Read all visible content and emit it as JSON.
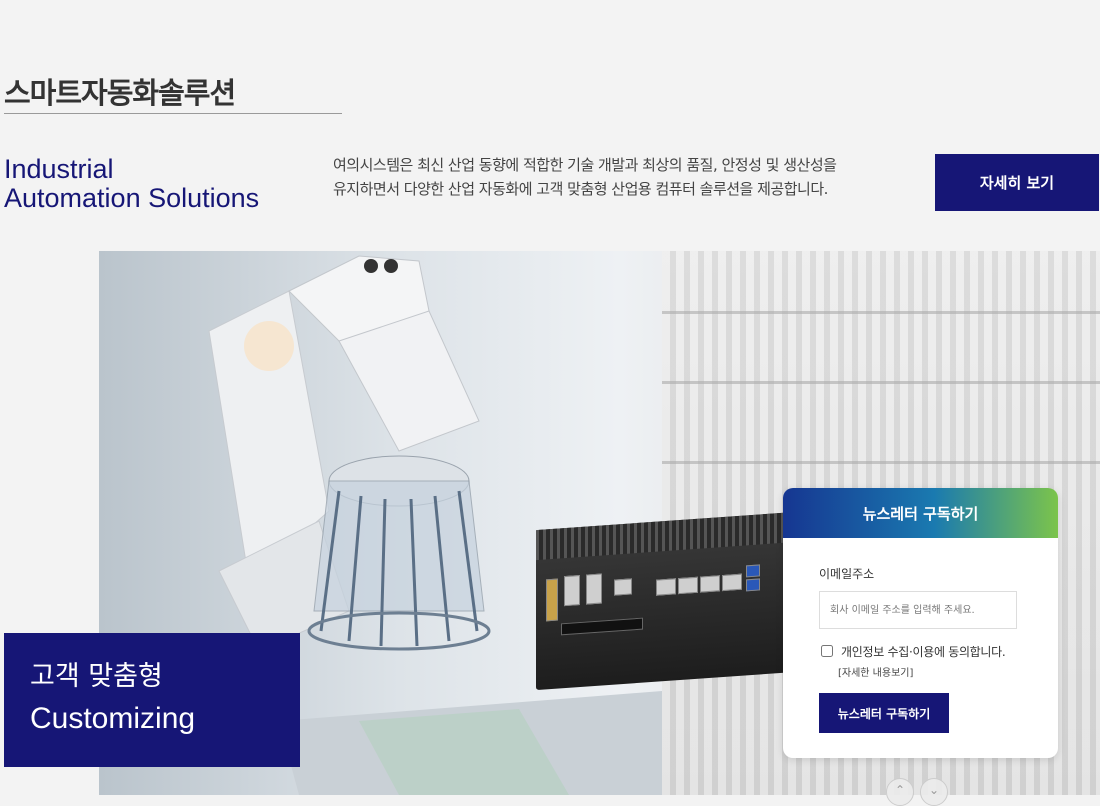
{
  "section": {
    "title": "스마트자동화솔루션",
    "en_heading_line1": "Industrial",
    "en_heading_line2": "Automation Solutions",
    "description_line1": "여의시스템은 최신 산업 동향에 적합한 기술 개발과 최상의 품질, 안정성 및 생산성을",
    "description_line2": "유지하면서 다양한 산업 자동화에 고객 맞춤형 산업용 컴퓨터 솔루션을 제공합니다.",
    "detail_button": "자세히 보기"
  },
  "hero": {
    "customizing_ko": "고객 맞춤형",
    "customizing_en": "Customizing"
  },
  "newsletter": {
    "header": "뉴스레터 구독하기",
    "email_label": "이메일주소",
    "email_placeholder": "회사 이메일 주소를 입력해 주세요.",
    "email_value": "",
    "agree_text": "개인정보 수집·이용에 동의합니다.",
    "detail_link": "[자세한 내용보기]",
    "subscribe_button": "뉴스레터 구독하기"
  },
  "colors": {
    "brand_navy": "#161676",
    "newsletter_gradient_start": "#163691",
    "newsletter_gradient_end": "#7cc44b"
  },
  "icons": {
    "scroll_prev": "chevron-up-icon",
    "scroll_next": "chevron-down-icon"
  }
}
